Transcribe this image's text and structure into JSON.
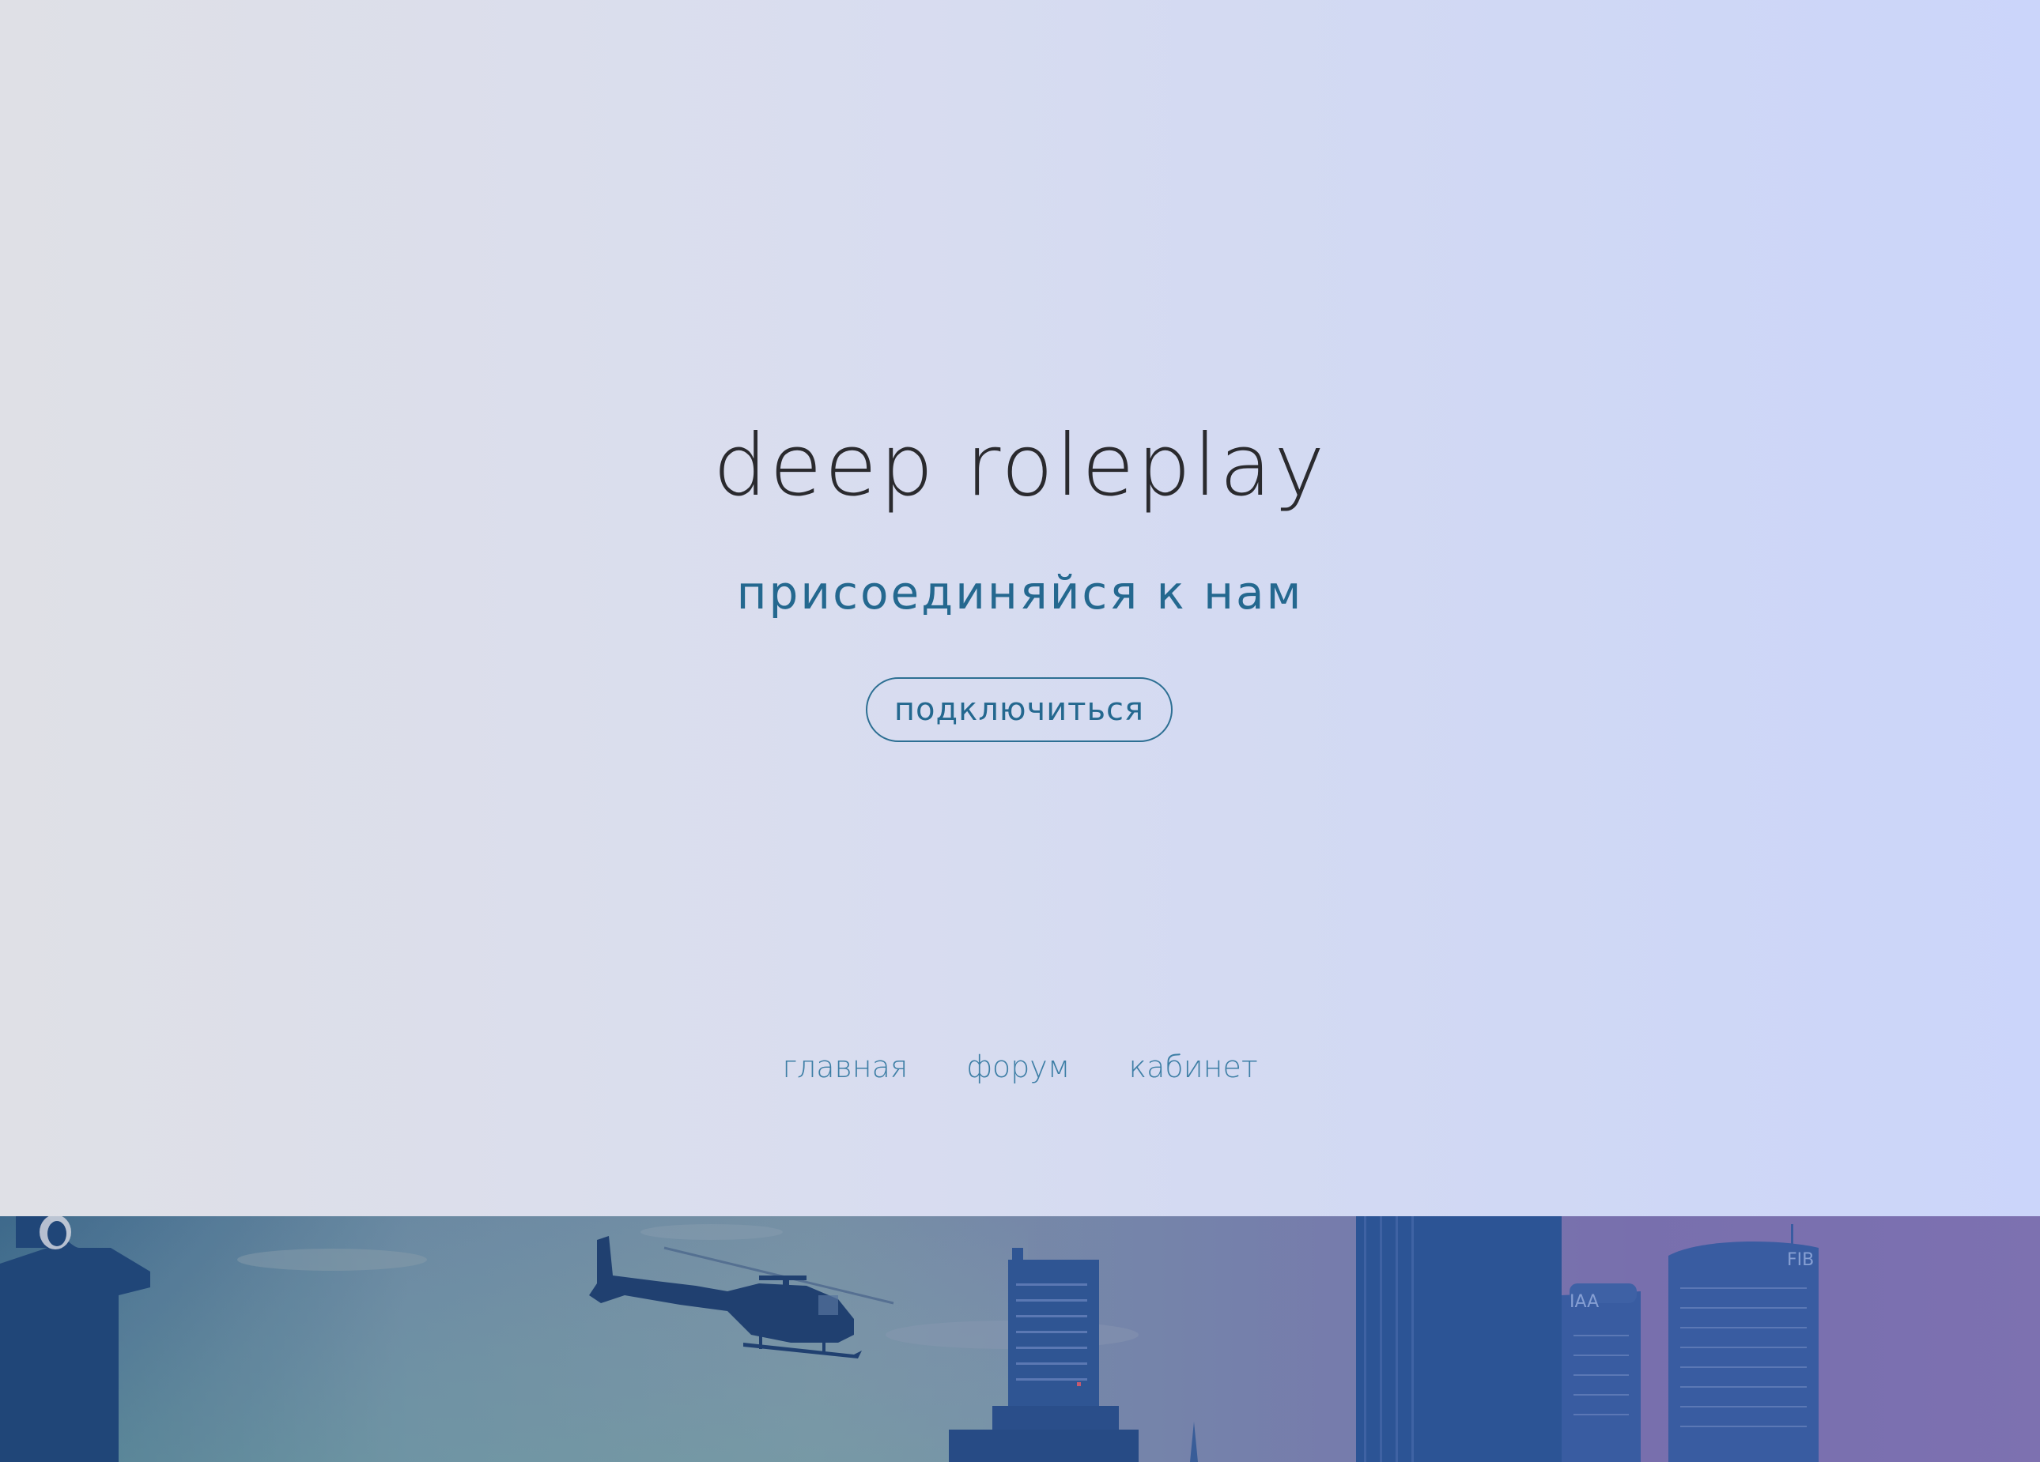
{
  "hero": {
    "title": "deep roleplay",
    "tagline": "присоединяйся к нам",
    "connect_button": "подключиться"
  },
  "nav": {
    "items": [
      {
        "label": "главная"
      },
      {
        "label": "форум"
      },
      {
        "label": "кабинет"
      }
    ]
  },
  "banner": {
    "tower_sign_1": "IAA",
    "tower_sign_2": "FIB"
  },
  "colors": {
    "hero_gradient_start": "#dfe0e6",
    "hero_gradient_end": "#cbd5fa",
    "title_color": "#2a2a2e",
    "accent_blue": "#24688f",
    "nav_link_color": "#3d7ea5",
    "banner_tint": "#2d4f8a"
  },
  "icons": [
    "helicopter-silhouette",
    "city-skyline"
  ]
}
